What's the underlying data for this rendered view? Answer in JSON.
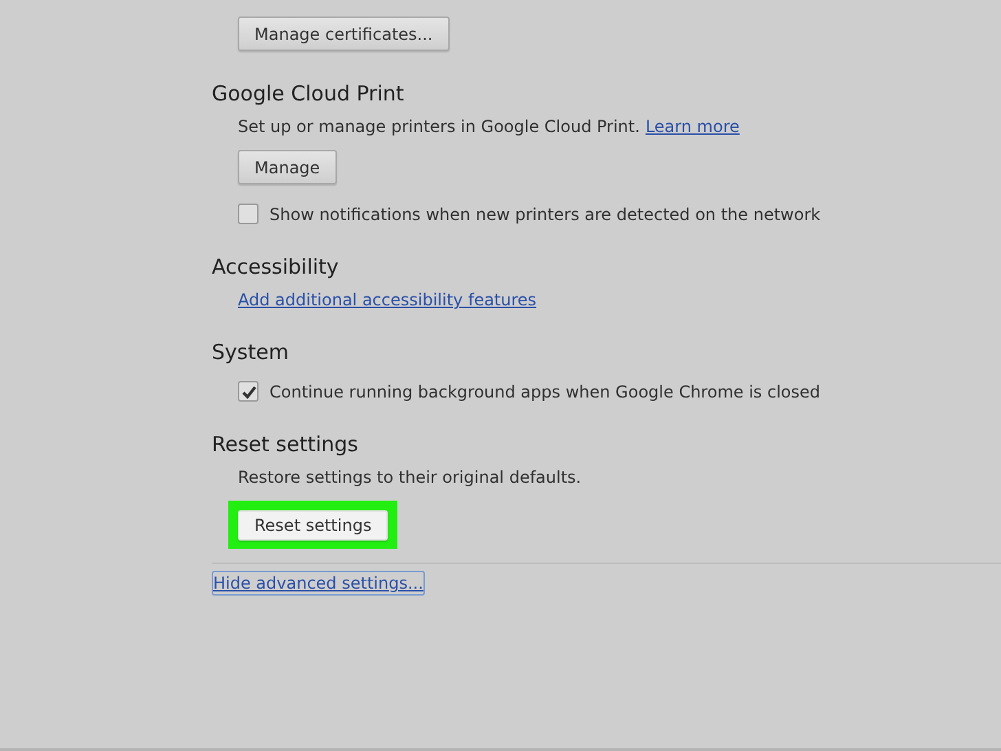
{
  "top_button": {
    "label": "Manage certificates..."
  },
  "sections": [
    {
      "title": "Google Cloud Print",
      "items": [
        {
          "kind": "text",
          "text": "Set up or manage printers in Google Cloud Print.",
          "link": "Learn more"
        },
        {
          "kind": "button",
          "label": "Manage",
          "highlighted": false
        },
        {
          "kind": "checkbox",
          "label": "Show notifications when new printers are detected on the network",
          "checked": false
        }
      ]
    },
    {
      "title": "Accessibility",
      "items": [
        {
          "kind": "link",
          "text": "Add additional accessibility features"
        }
      ]
    },
    {
      "title": "System",
      "items": [
        {
          "kind": "checkbox",
          "label": "Continue running background apps when Google Chrome is closed",
          "checked": true
        }
      ]
    },
    {
      "title": "Reset settings",
      "items": [
        {
          "kind": "text",
          "text": "Restore settings to their original defaults."
        },
        {
          "kind": "button",
          "label": "Reset settings",
          "highlighted": true
        }
      ]
    }
  ],
  "footer_link": "Hide advanced settings..."
}
